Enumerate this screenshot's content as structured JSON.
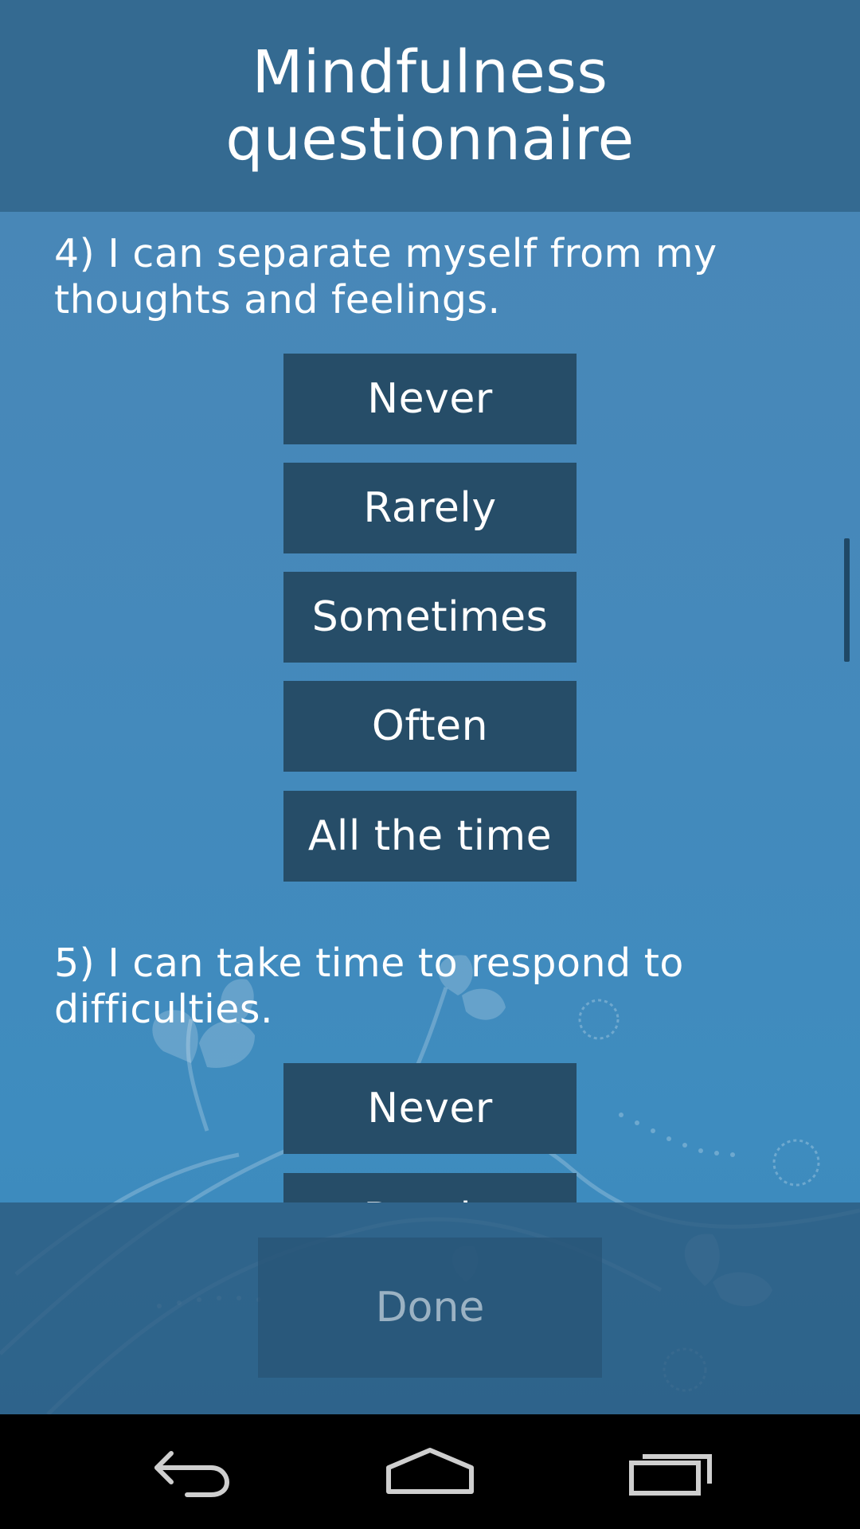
{
  "header": {
    "title": "Mindfulness questionnaire"
  },
  "questions": [
    {
      "text": "4) I can separate myself from my thoughts and feelings.",
      "options": [
        "Never",
        "Rarely",
        "Sometimes",
        "Often",
        "All the time"
      ]
    },
    {
      "text": "5) I can take time to respond to difficulties.",
      "options": [
        "Never",
        "Rarely"
      ]
    }
  ],
  "footer": {
    "done_label": "Done"
  },
  "navbar": {
    "icons": [
      "back-icon",
      "home-icon",
      "recent-apps-icon"
    ]
  },
  "colors": {
    "header_bg": "#346a91",
    "option_bg": "#264d68",
    "background": "#4589bb",
    "footer_bg": "#2c5c80",
    "done_text": "#9bb2c3"
  }
}
